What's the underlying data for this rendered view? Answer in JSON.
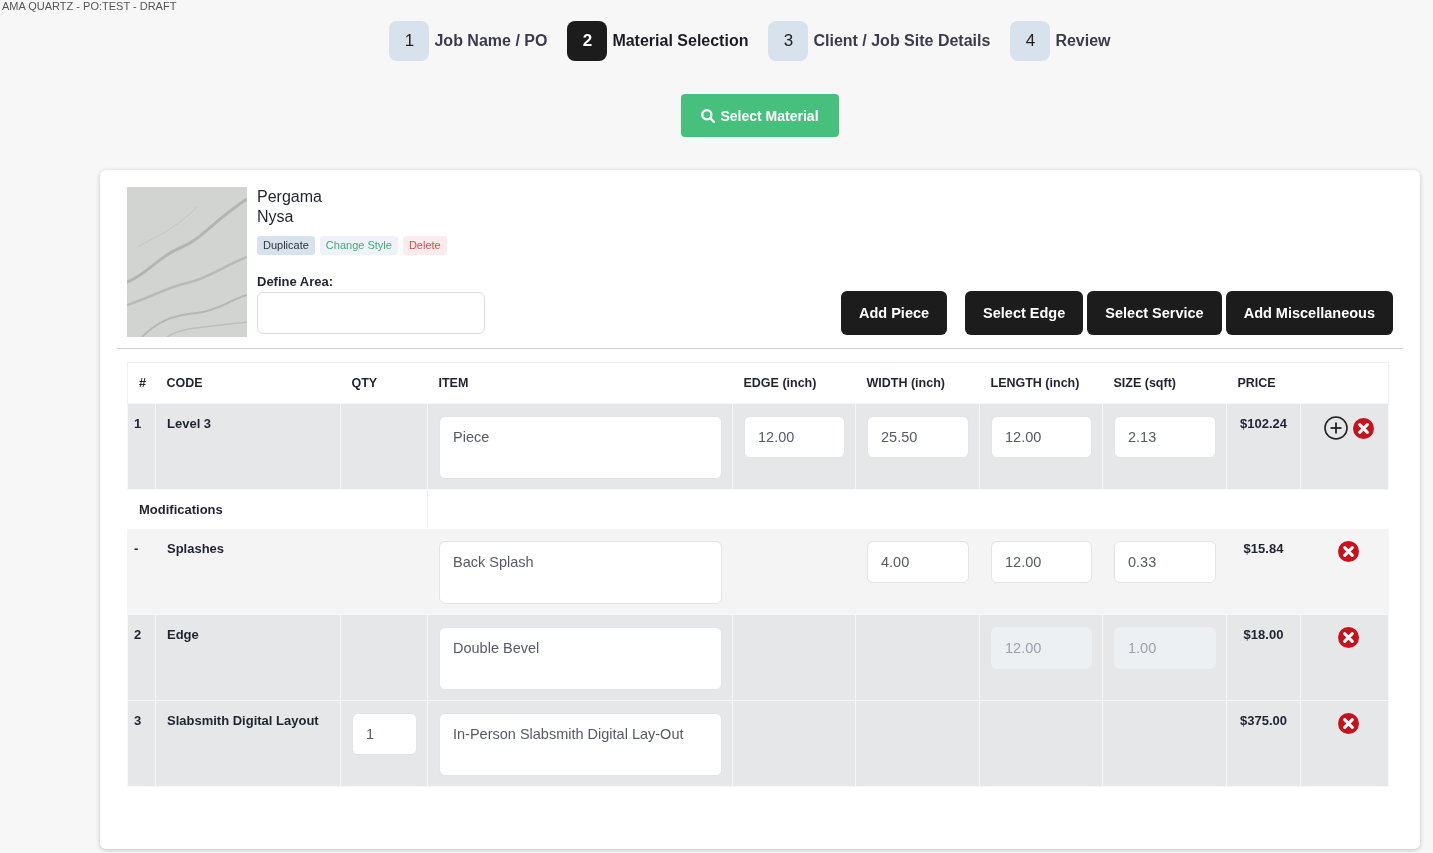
{
  "breadcrumb": "AMA QUARTZ - PO:TEST - DRAFT",
  "steps": [
    {
      "number": "1",
      "label": "Job Name / PO",
      "selected": false
    },
    {
      "number": "2",
      "label": "Material Selection",
      "selected": true
    },
    {
      "number": "3",
      "label": "Client / Job Site Details",
      "selected": false
    },
    {
      "number": "4",
      "label": "Review",
      "selected": false
    }
  ],
  "select_material_button": {
    "label": "Select Material"
  },
  "material": {
    "brand": "Pergama",
    "name": "Nysa",
    "actions": [
      {
        "label": "Duplicate",
        "kind": "duplicate"
      },
      {
        "label": "Change Style",
        "kind": "change_style"
      },
      {
        "label": "Delete",
        "kind": "delete"
      }
    ],
    "define_area": {
      "label": "Define Area:"
    }
  },
  "toolbar_buttons": [
    {
      "label": "Add Piece"
    },
    {
      "label": "Select Edge"
    },
    {
      "label": "Select Service"
    },
    {
      "label": "Add Miscellaneous"
    }
  ],
  "table": {
    "columns": [
      "#",
      "CODE",
      "QTY",
      "ITEM",
      "EDGE (inch)",
      "WIDTH (inch)",
      "LENGTH (inch)",
      "SIZE (sqft)",
      "PRICE"
    ],
    "rows": [
      {
        "kind": "line",
        "number": "1",
        "code": "Level 3",
        "item": {
          "value": "Piece",
          "disabled": false
        },
        "edge": {
          "value": "12.00",
          "disabled": false
        },
        "width": {
          "value": "25.50",
          "disabled": false
        },
        "length": {
          "value": "12.00",
          "disabled": false
        },
        "size": {
          "value": "2.13",
          "disabled": false
        },
        "price": "$102.24",
        "add_action": true
      },
      {
        "kind": "section",
        "label": "Modifications"
      },
      {
        "kind": "modification",
        "number": "-",
        "code": "Splashes",
        "item": {
          "value": "Back Splash",
          "disabled": false
        },
        "width": {
          "value": "4.00",
          "disabled": false
        },
        "length": {
          "value": "12.00",
          "disabled": false
        },
        "size": {
          "value": "0.33",
          "disabled": false
        },
        "price": "$15.84",
        "add_action": false
      },
      {
        "kind": "line",
        "number": "2",
        "code": "Edge",
        "item": {
          "value": "Double Bevel",
          "disabled": false
        },
        "length": {
          "value": "12.00",
          "disabled": true
        },
        "size": {
          "value": "1.00",
          "disabled": true
        },
        "price": "$18.00",
        "add_action": false
      },
      {
        "kind": "line",
        "number": "3",
        "code": "Slabsmith Digital Layout",
        "qty": {
          "value": "1",
          "disabled": false
        },
        "item": {
          "value": "In-Person Slabsmith Digital Lay-Out",
          "disabled": false
        },
        "price": "$375.00",
        "add_action": false
      }
    ]
  }
}
